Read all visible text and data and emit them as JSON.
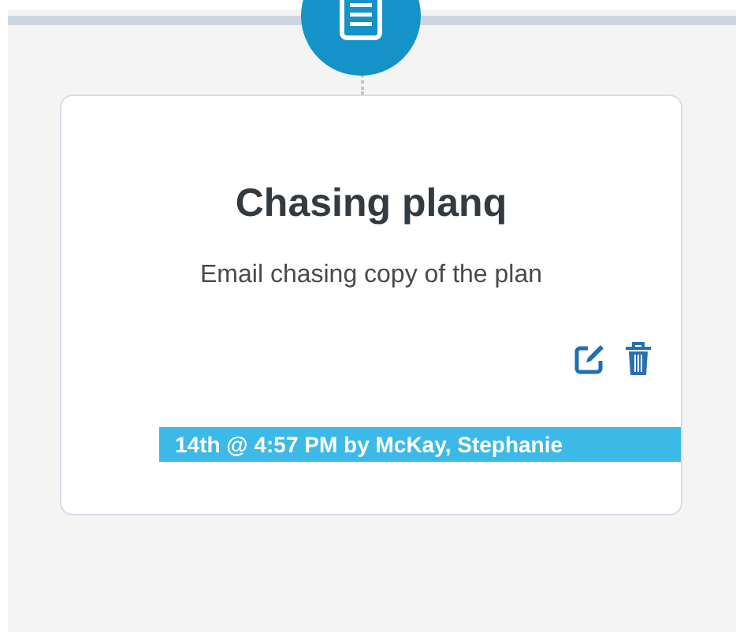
{
  "card": {
    "title": "Chasing planq",
    "description": "Email chasing copy of the plan",
    "stamp": "14th @ 4:57 PM by McKay, Stephanie"
  }
}
